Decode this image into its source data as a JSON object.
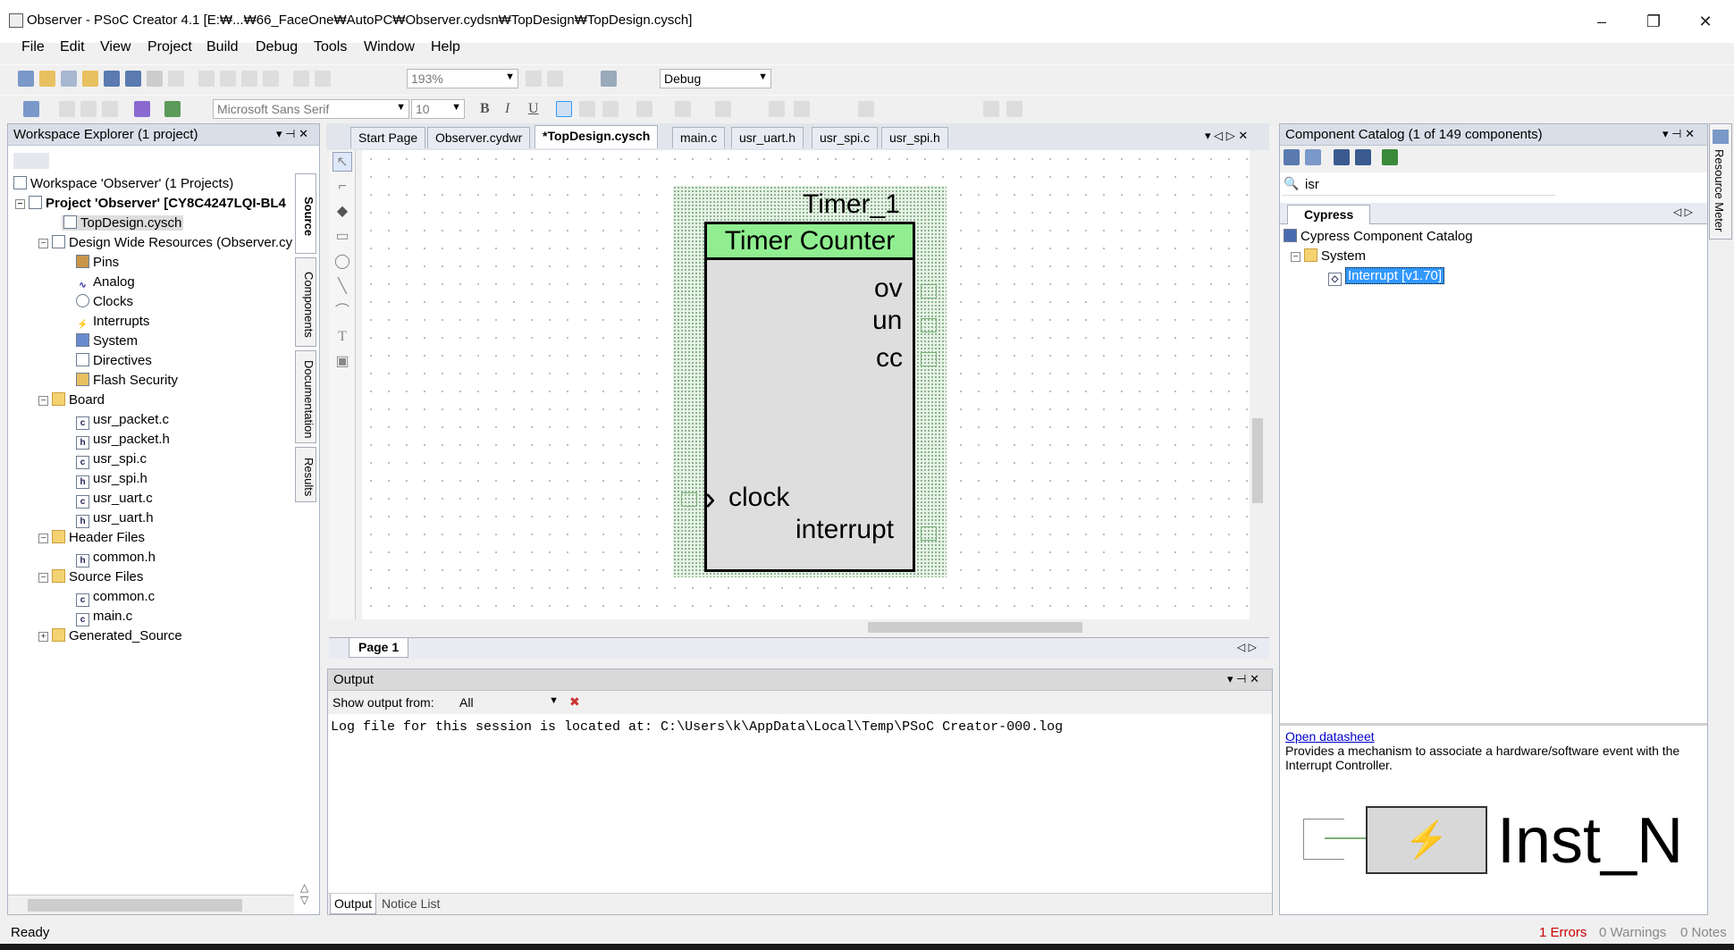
{
  "title": "Observer - PSoC Creator 4.1  [E:₩...₩66_FaceOne₩AutoPC₩Observer.cydsn₩TopDesign₩TopDesign.cysch]",
  "window_controls": {
    "minimize": "–",
    "maximize": "❐",
    "close": "✕"
  },
  "menu": [
    "File",
    "Edit",
    "View",
    "Project",
    "Build",
    "Debug",
    "Tools",
    "Window",
    "Help"
  ],
  "toolbar": {
    "zoom": "193%",
    "config": "Debug",
    "font": "Microsoft Sans Serif",
    "font_size": "10",
    "bold": "B",
    "italic": "I",
    "underline": "U"
  },
  "workspace": {
    "title": "Workspace Explorer (1 project)",
    "workspace": "Workspace 'Observer' (1 Projects)",
    "project": "Project  'Observer' [CY8C4247LQI-BL4",
    "top_design": "TopDesign.cysch",
    "dwr": "Design Wide Resources (Observer.cy",
    "dwr_items": [
      "Pins",
      "Analog",
      "Clocks",
      "Interrupts",
      "System",
      "Directives",
      "Flash Security"
    ],
    "board": "Board",
    "board_files": [
      "usr_packet.c",
      "usr_packet.h",
      "usr_spi.c",
      "usr_spi.h",
      "usr_uart.c",
      "usr_uart.h"
    ],
    "header_folder": "Header Files",
    "header_files": [
      "common.h"
    ],
    "source_folder": "Source Files",
    "source_files": [
      "common.c",
      "main.c"
    ],
    "generated": "Generated_Source"
  },
  "side_tabs": [
    "Source",
    "Components",
    "Documentation",
    "Results"
  ],
  "doc_tabs": [
    "Start Page",
    "Observer.cydwr",
    "*TopDesign.cysch",
    "main.c",
    "usr_uart.h",
    "usr_spi.c",
    "usr_spi.h"
  ],
  "schematic": {
    "instance": "Timer_1",
    "component": "Timer Counter",
    "outputs": [
      "ov",
      "un",
      "cc"
    ],
    "input": "clock",
    "interrupt": "interrupt"
  },
  "page_tab": "Page 1",
  "output": {
    "title": "Output",
    "show_from_label": "Show output from:",
    "show_from_value": "All",
    "log": "Log file for this session is located at: C:\\Users\\k\\AppData\\Local\\Temp\\PSoC Creator-000.log",
    "tabs": [
      "Output",
      "Notice List"
    ]
  },
  "catalog": {
    "title": "Component Catalog (1 of 149 components)",
    "search": "isr",
    "tab": "Cypress",
    "root": "Cypress Component Catalog",
    "system": "System",
    "item": "Interrupt [v1.70]",
    "datasheet_link": "Open datasheet",
    "description": "Provides a mechanism to associate a hardware/software event with the Interrupt Controller.",
    "preview_label": "Inst_N"
  },
  "right_strip": "Resource Meter",
  "status": {
    "left": "Ready",
    "errors": "1 Errors",
    "warnings": "0 Warnings",
    "notes": "0 Notes"
  },
  "colors": {
    "component_header": "#90ee90",
    "selection": "#3399ff",
    "error": "#cc0000",
    "terminal": "#7ab27a"
  }
}
